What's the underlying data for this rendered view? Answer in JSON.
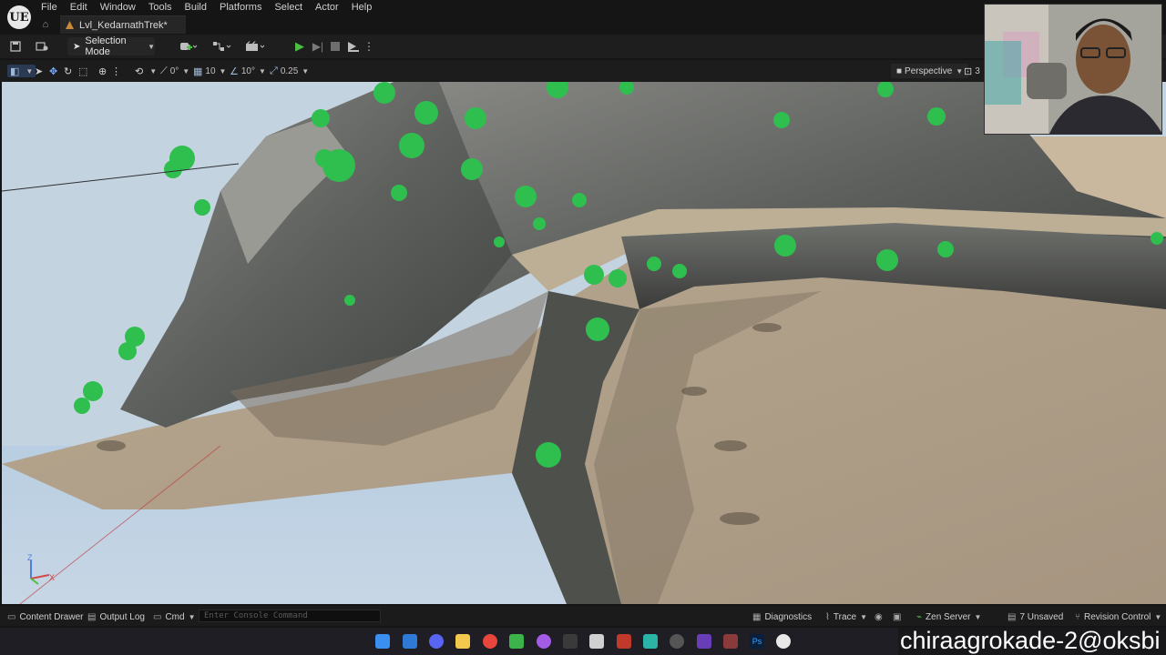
{
  "app": {
    "logo": "UE",
    "menu": [
      "File",
      "Edit",
      "Window",
      "Tools",
      "Build",
      "Platforms",
      "Select",
      "Actor",
      "Help"
    ],
    "level_tab": "Lvl_KedarnathTrek*"
  },
  "toolbar": {
    "selection_mode": "Selection Mode"
  },
  "viewport_toolbar": {
    "rotation_snap": "0°",
    "grid_snap": "10",
    "angle_snap": "10°",
    "scale_snap": "0.25",
    "view_mode": "Perspective",
    "extra": "3"
  },
  "viewport": {
    "axis_z": "Z",
    "axis_x": "X"
  },
  "statusbar": {
    "content_drawer": "Content Drawer",
    "output_log": "Output Log",
    "cmd": "Cmd",
    "console_placeholder": "Enter Console Command",
    "diagnostics": "Diagnostics",
    "trace": "Trace",
    "zen_server": "Zen Server",
    "unsaved": "7 Unsaved",
    "revision_control": "Revision Control"
  },
  "overlay": {
    "watermark": "chiraagrokade-2@oksbi"
  },
  "colors": {
    "play_green": "#4bbf43",
    "level_tab_icon": "#c7893a",
    "tree_green": "#2fbf4f"
  }
}
